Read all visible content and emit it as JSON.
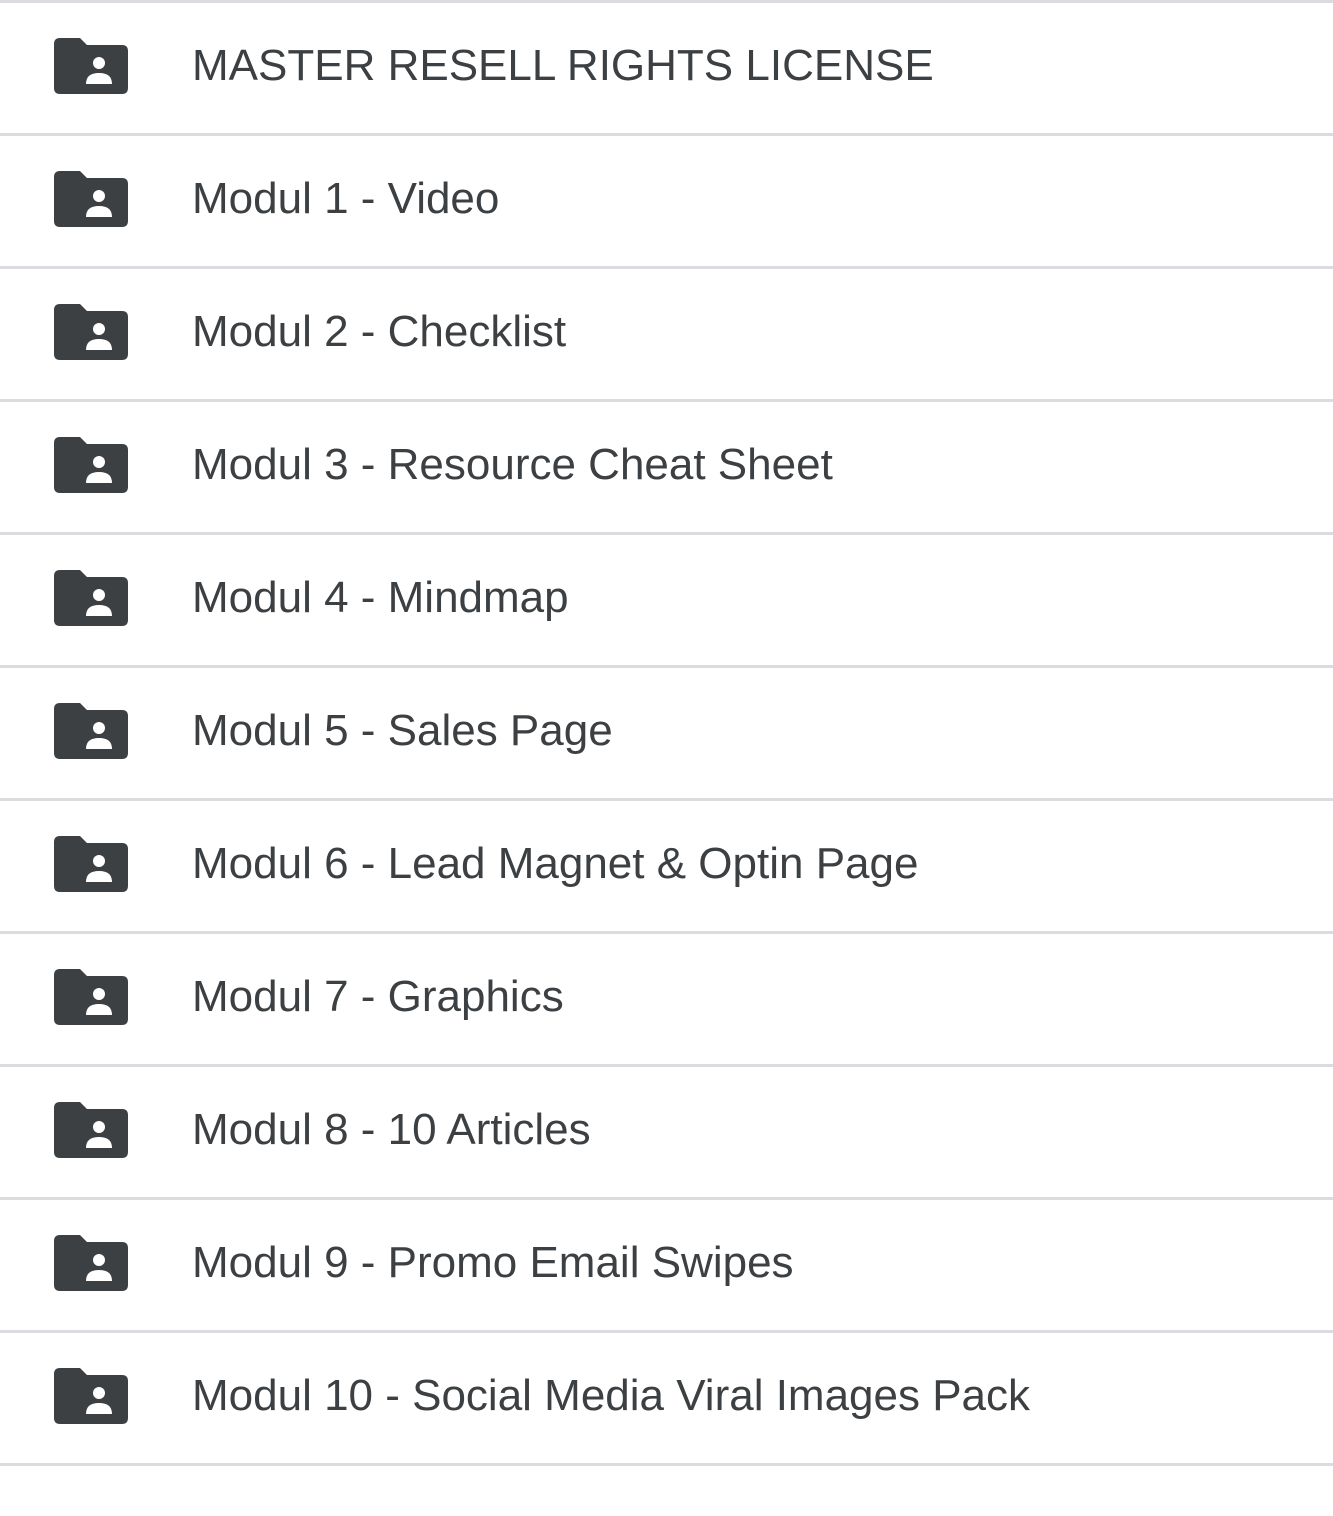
{
  "folder_list": {
    "icon": "shared-folder-icon",
    "icon_color": "#3c4043",
    "divider_color": "#dadce0",
    "text_color": "#3c4043",
    "items": [
      {
        "label": "MASTER RESELL RIGHTS LICENSE"
      },
      {
        "label": "Modul 1 - Video"
      },
      {
        "label": "Modul 2 - Checklist"
      },
      {
        "label": "Modul 3 - Resource Cheat Sheet"
      },
      {
        "label": "Modul 4 - Mindmap"
      },
      {
        "label": "Modul 5 - Sales Page"
      },
      {
        "label": "Modul 6 - Lead Magnet & Optin Page"
      },
      {
        "label": "Modul 7 - Graphics"
      },
      {
        "label": "Modul 8 - 10 Articles"
      },
      {
        "label": "Modul 9 - Promo Email Swipes"
      },
      {
        "label": "Modul 10 - Social Media Viral Images Pack"
      }
    ]
  }
}
